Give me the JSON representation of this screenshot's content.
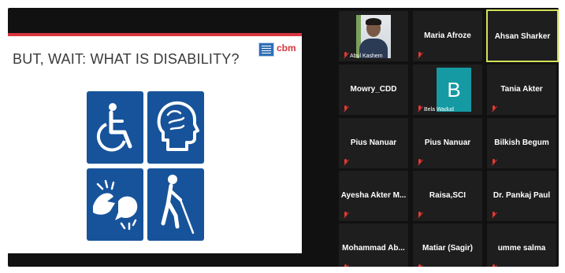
{
  "slide": {
    "title": "BUT, WAIT: WHAT IS DISABILITY?",
    "logo": "cbm",
    "icons": [
      "wheelchair-icon",
      "cognitive-head-icon",
      "sign-language-icon",
      "blind-cane-icon"
    ]
  },
  "participants": [
    {
      "name": "Abul Kashem",
      "video": true,
      "muted": true
    },
    {
      "name": "Maria Afroze",
      "muted": true
    },
    {
      "name": "Ahsan Sharker",
      "active": true
    },
    {
      "name": "Mowry_CDD",
      "muted": true
    },
    {
      "name": "Bela Wadud",
      "avatar_letter": "B",
      "muted": true
    },
    {
      "name": "Tania Akter",
      "muted": true
    },
    {
      "name": "Pius Nanuar",
      "muted": true
    },
    {
      "name": "Pius Nanuar",
      "muted": true
    },
    {
      "name": "Bilkish Begum",
      "muted": true
    },
    {
      "name": "Ayesha Akter M...",
      "muted": true
    },
    {
      "name": "Raisa,SCI",
      "muted": true
    },
    {
      "name": "Dr. Pankaj Paul",
      "muted": true
    },
    {
      "name": "Mohammad Ab...",
      "muted": true
    },
    {
      "name": "Matiar (Sagir)",
      "muted": true
    },
    {
      "name": "umme salma",
      "muted": true
    }
  ],
  "colors": {
    "background": "#111111",
    "tile": "#1e1e1e",
    "active_border": "#d4e157",
    "muted_icon": "#e53935",
    "slide_icon_bg": "#17539a",
    "avatar_bg": "#159aa3",
    "slide_accent": "#d9363e"
  }
}
